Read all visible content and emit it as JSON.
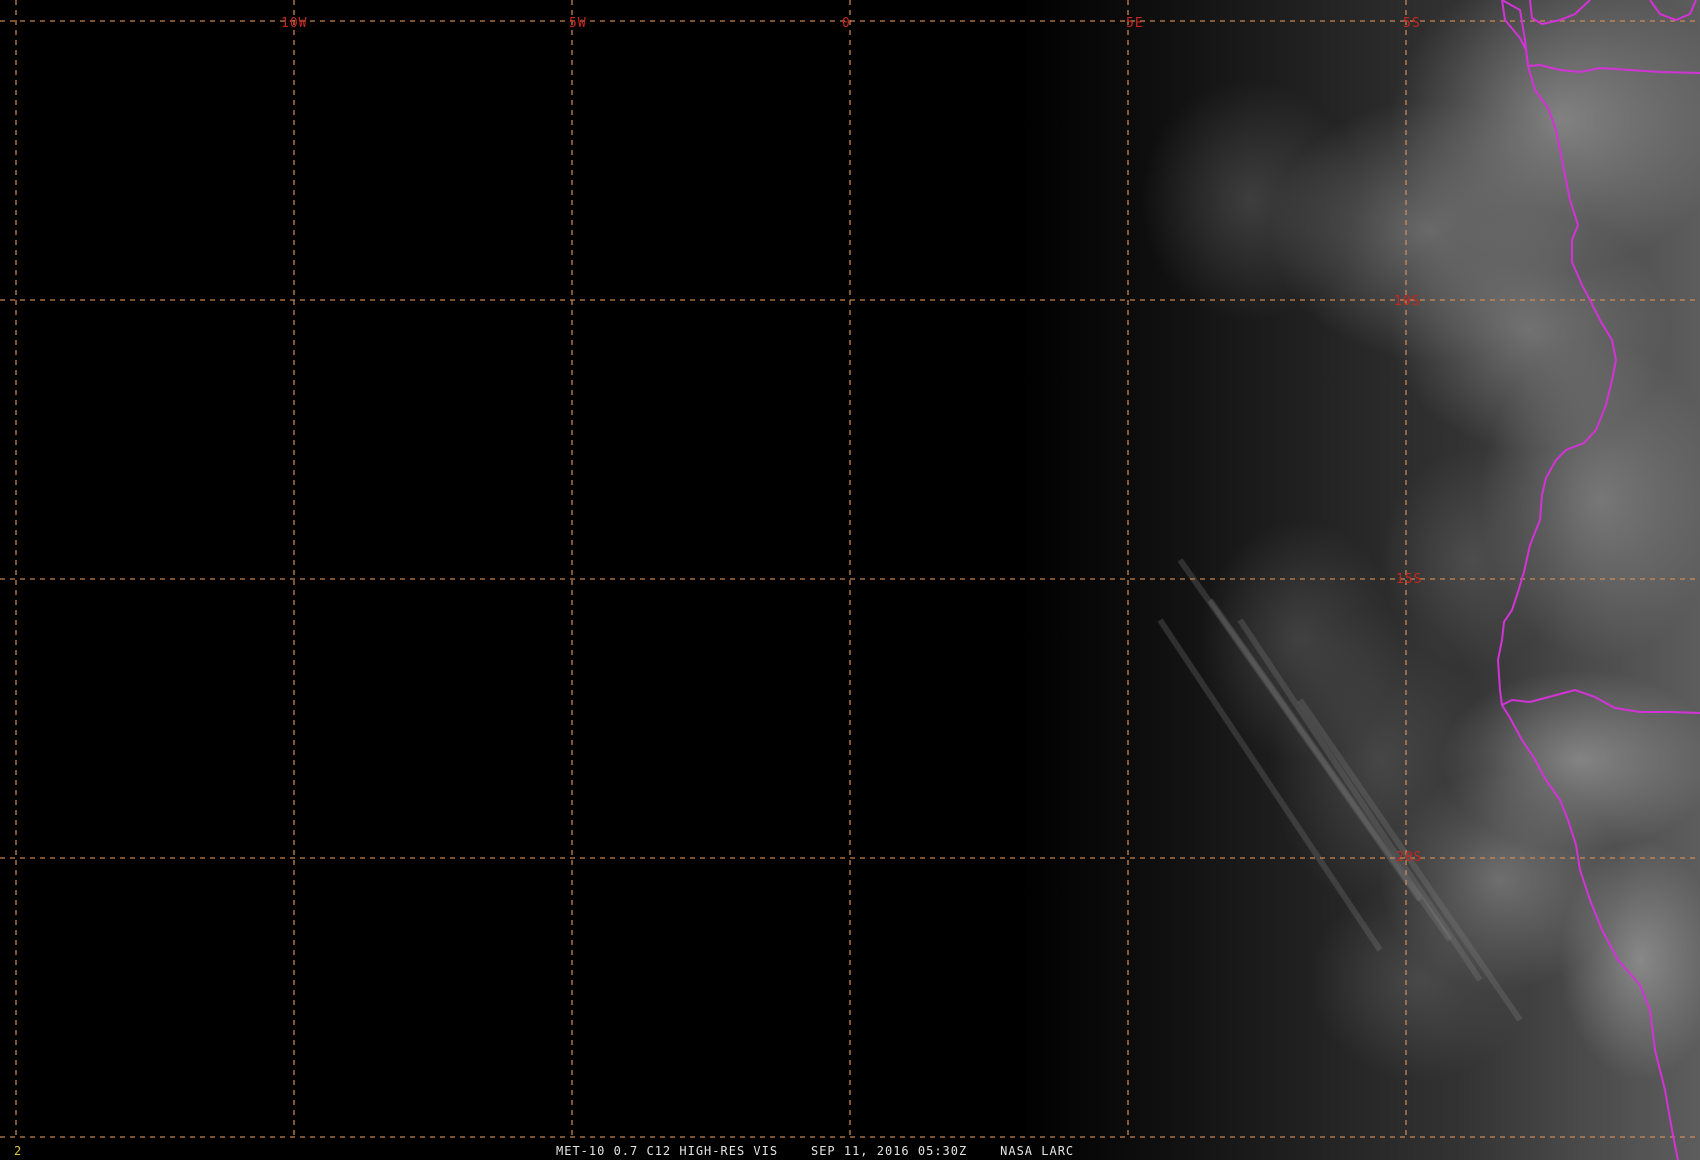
{
  "product": {
    "satellite": "MET-10",
    "channel": "0.7 C12 HIGH-RES VIS",
    "datetime": "SEP 11, 2016 05:30Z",
    "credit": "NASA LARC",
    "caption": "MET-10 0.7 C12 HIGH-RES VIS    SEP 11, 2016 05:30Z    NASA LARC",
    "panel_number": "2"
  },
  "grid": {
    "longitude_labels": [
      "10W",
      "5W",
      "0",
      "5E"
    ],
    "latitude_labels": [
      "5S",
      "10S",
      "15S",
      "20S"
    ],
    "longitudes_deg": [
      -15,
      -10,
      -5,
      0,
      5,
      10
    ],
    "latitudes_deg": [
      -5,
      -10,
      -15,
      -20,
      -25
    ]
  },
  "overlays": {
    "boundaries": "political boundaries",
    "boundary_color": "#d233d6",
    "grid_color": "#d9925a",
    "label_color": "#c8261f"
  },
  "scene": {
    "description_free": true,
    "night_side": "west",
    "day_side": "east"
  }
}
